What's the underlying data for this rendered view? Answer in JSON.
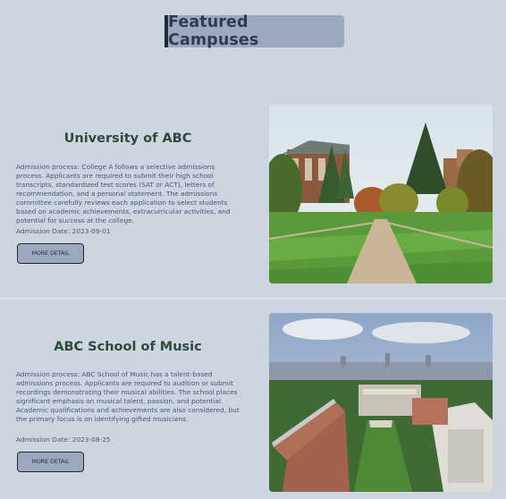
{
  "header": {
    "title": "Featured Campuses"
  },
  "campuses": [
    {
      "name": "University of ABC",
      "description": "Admission process: College A follows a selective admissions process. Applicants are required to submit their high school transcripts, standardized test scores (SAT or ACT), letters of recommendation, and a personal statement. The admissions committee carefully reviews each application to select students based on academic achievements, extracurricular activities, and potential for success at the college.",
      "admission_date": "Admission Date: 2023-09-01",
      "button_label": "MORE DETAIL"
    },
    {
      "name": "ABC School of Music",
      "description": "Admission process: ABC School of Music has a talent-based admissions process. Applicants are required to audition or submit recordings demonstrating their musical abilities. The school places significant emphasis on musical talent, passion, and potential. Academic qualifications and achievements are also considered, but the primary focus is on identifying gifted musicians.",
      "admission_date": "Admission Date: 2023-08-25",
      "button_label": "MORE DETAIL"
    }
  ]
}
